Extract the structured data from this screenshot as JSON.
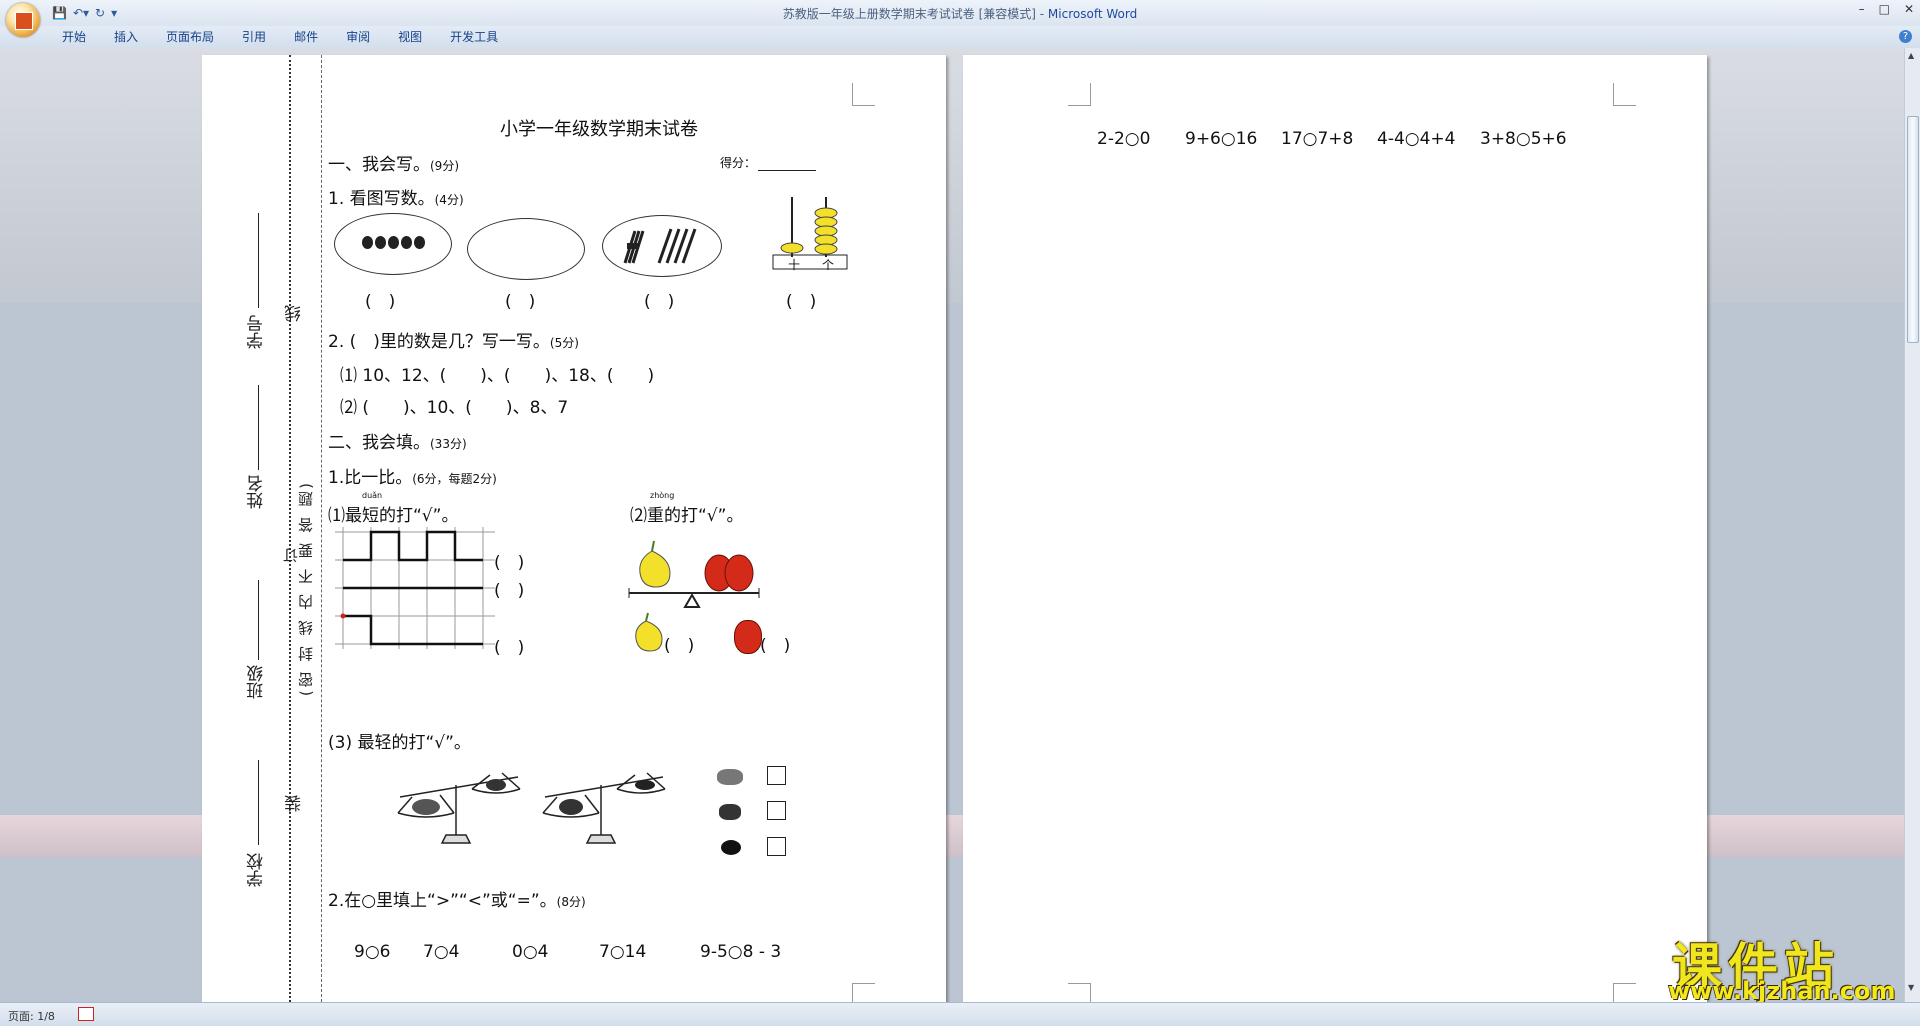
{
  "window": {
    "title": "苏教版一年级上册数学期末考试试卷 [兼容模式] - ",
    "app": "Microsoft Word",
    "controls": [
      "–",
      "□",
      "✕"
    ]
  },
  "quick_access": [
    "save-icon",
    "undo-icon",
    "redo-icon",
    "customize-icon"
  ],
  "ribbon_tabs": [
    "开始",
    "插入",
    "页面布局",
    "引用",
    "邮件",
    "审阅",
    "视图",
    "开发工具"
  ],
  "statusbar": {
    "page": "页面: 1/8"
  },
  "page1": {
    "margin": {
      "student_no": "学号",
      "name": "姓名",
      "class": "班级",
      "school": "学校",
      "xian": "线",
      "zhuang": "装",
      "notice": "(密 封 线 内 不 要 答 题)",
      "ding": "订"
    },
    "title": "小学一年级数学期末试卷",
    "sec1": {
      "label": "一、我会写。",
      "pts": "(9分)",
      "score_label": "得分："
    },
    "q1": {
      "label": "1. 看图写数。",
      "pts": "(4分)",
      "abacus_ten": "十",
      "abacus_one": "个"
    },
    "parens": "(　)",
    "q2": {
      "label": "2. (　)里的数是几？写一写。",
      "pts": "(5分)",
      "line1": "⑴  10、12、(　　)、(　　)、18、(　　)",
      "line2": "⑵  (　　)、10、(　　)、8、7"
    },
    "sec2": {
      "label": "二、我会填。",
      "pts": "(33分)"
    },
    "q21": {
      "label": "1.比一比。",
      "pts": "(6分，每题2分)"
    },
    "sub1": {
      "label": "⑴最短的打“√”。",
      "pinyin": "duǎn"
    },
    "sub2": {
      "label": "⑵重的打“√”。",
      "pinyin": "zhòng"
    },
    "sub3": {
      "label": "(3)  最轻的打“√”。"
    },
    "q22": {
      "label": "2.在○里填上“>”“<”或“=”。",
      "pts": "(8分)"
    },
    "compare_row": [
      "9○6",
      "7○4",
      "0○4",
      "7○14",
      "9-5○8 - 3"
    ]
  },
  "page2": {
    "compare_row": [
      "2-2○0",
      "9+6○16",
      "17○7+8",
      "4-4○4+4",
      "3+8○5+6"
    ]
  },
  "watermark": {
    "main": "课件站",
    "url": "www.kjzhan.com"
  },
  "colors": {
    "ribbon_text": "#15428b",
    "watermark": "#f0e61e",
    "pear": "#f2e02a",
    "apple": "#d42a1a"
  }
}
